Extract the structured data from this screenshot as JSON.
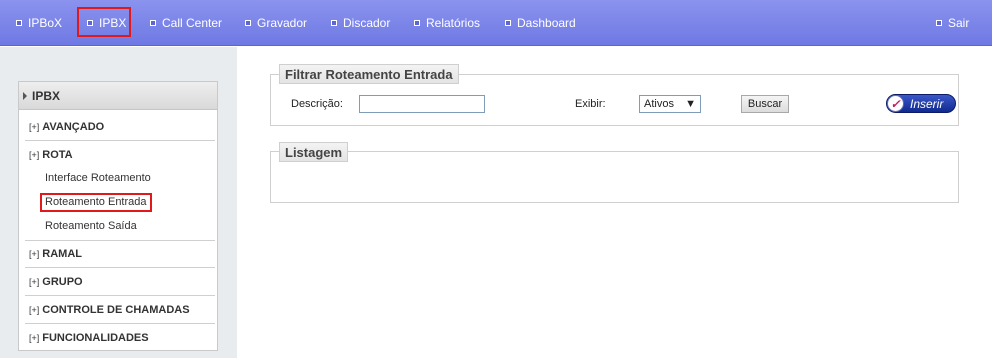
{
  "topnav": {
    "items": [
      {
        "label": "IPBoX"
      },
      {
        "label": "IPBX"
      },
      {
        "label": "Call Center"
      },
      {
        "label": "Gravador"
      },
      {
        "label": "Discador"
      },
      {
        "label": "Relatórios"
      },
      {
        "label": "Dashboard"
      }
    ],
    "logout": "Sair"
  },
  "sidebar": {
    "header": "IPBX",
    "groups": [
      {
        "label": "AVANÇADO"
      },
      {
        "label": "ROTA"
      },
      {
        "label": "RAMAL"
      },
      {
        "label": "GRUPO"
      },
      {
        "label": "CONTROLE DE CHAMADAS"
      },
      {
        "label": "FUNCIONALIDADES"
      }
    ],
    "expand_marker": "[+]",
    "rota_items": [
      {
        "label": "Interface Roteamento"
      },
      {
        "label": "Roteamento Entrada"
      },
      {
        "label": "Roteamento Saída"
      }
    ]
  },
  "filter": {
    "title": "Filtrar Roteamento Entrada",
    "descricao_label": "Descrição:",
    "descricao_value": "",
    "exibir_label": "Exibir:",
    "exibir_value": "Ativos",
    "search_label": "Buscar",
    "insert_label": "Inserir"
  },
  "listagem": {
    "title": "Listagem"
  },
  "colors": {
    "nav_bg": "#7a83e8",
    "highlight": "#e01a1a",
    "insert_btn": "#1b3aa8"
  }
}
